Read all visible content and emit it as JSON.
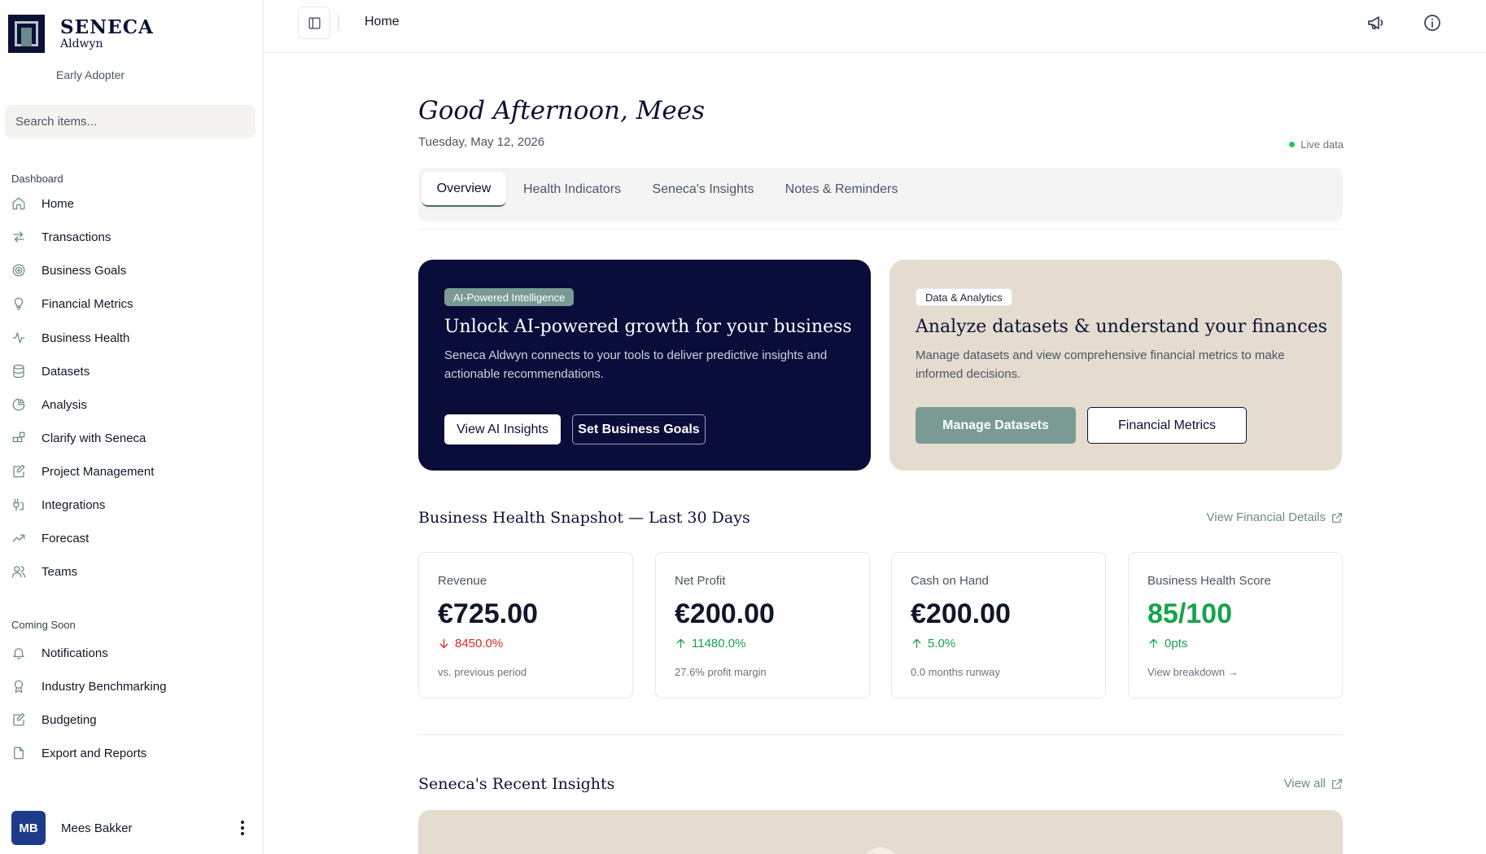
{
  "brand": {
    "name": "SENECA",
    "sub": "Aldwyn",
    "plan": "Early Adopter"
  },
  "search": {
    "placeholder": "Search items..."
  },
  "sidebar": {
    "section_dashboard": "Dashboard",
    "items": [
      {
        "label": "Home",
        "icon": "home-icon"
      },
      {
        "label": "Transactions",
        "icon": "arrows-swap-icon"
      },
      {
        "label": "Business Goals",
        "icon": "target-icon"
      },
      {
        "label": "Financial Metrics",
        "icon": "lightbulb-icon"
      },
      {
        "label": "Business Health",
        "icon": "activity-icon"
      },
      {
        "label": "Datasets",
        "icon": "database-icon"
      },
      {
        "label": "Analysis",
        "icon": "pie-chart-icon"
      },
      {
        "label": "Clarify with Seneca",
        "icon": "blocks-icon"
      },
      {
        "label": "Project Management",
        "icon": "edit-doc-icon"
      },
      {
        "label": "Integrations",
        "icon": "plug-icon"
      },
      {
        "label": "Forecast",
        "icon": "trend-icon"
      },
      {
        "label": "Teams",
        "icon": "users-icon"
      }
    ],
    "section_coming": "Coming Soon",
    "coming_items": [
      {
        "label": "Notifications",
        "icon": "bell-icon"
      },
      {
        "label": "Industry Benchmarking",
        "icon": "award-icon"
      },
      {
        "label": "Budgeting",
        "icon": "edit-doc-icon"
      },
      {
        "label": "Export and Reports",
        "icon": "file-icon"
      }
    ]
  },
  "user": {
    "initials": "MB",
    "name": "Mees Bakker"
  },
  "topbar": {
    "breadcrumb": "Home"
  },
  "header": {
    "greeting": "Good Afternoon, Mees",
    "date": "Tuesday, May 12, 2026",
    "live": "Live data"
  },
  "tabs": [
    "Overview",
    "Health Indicators",
    "Seneca's Insights",
    "Notes & Reminders"
  ],
  "hero_ai": {
    "badge": "AI-Powered Intelligence",
    "title": "Unlock AI-powered growth for your business",
    "desc": "Seneca Aldwyn connects to your tools to deliver predictive insights and actionable recommendations.",
    "btn1": "View AI Insights",
    "btn2": "Set Business Goals"
  },
  "hero_data": {
    "badge": "Data & Analytics",
    "title": "Analyze datasets & understand your finances",
    "desc": "Manage datasets and view comprehensive financial metrics to make informed decisions.",
    "btn1": "Manage Datasets",
    "btn2": "Financial Metrics"
  },
  "snapshot": {
    "title": "Business Health Snapshot — Last 30 Days",
    "link": "View Financial Details",
    "metrics": [
      {
        "label": "Revenue",
        "value": "€725.00",
        "change": "8450.0%",
        "direction": "down",
        "note": "vs. previous period"
      },
      {
        "label": "Net Profit",
        "value": "€200.00",
        "change": "11480.0%",
        "direction": "up",
        "note": "27.6% profit margin"
      },
      {
        "label": "Cash on Hand",
        "value": "€200.00",
        "change": "5.0%",
        "direction": "up",
        "note": "0.0 months runway"
      },
      {
        "label": "Business Health Score",
        "value": "85/100",
        "change": "0pts",
        "direction": "up",
        "note": "View breakdown →"
      }
    ]
  },
  "insights": {
    "title": "Seneca's Recent Insights",
    "link": "View all"
  },
  "colors": {
    "navy": "#0a0c3a",
    "sage": "#6b8a8d",
    "sand": "#e4dccf",
    "up": "#16a34a",
    "down": "#dc2626"
  }
}
